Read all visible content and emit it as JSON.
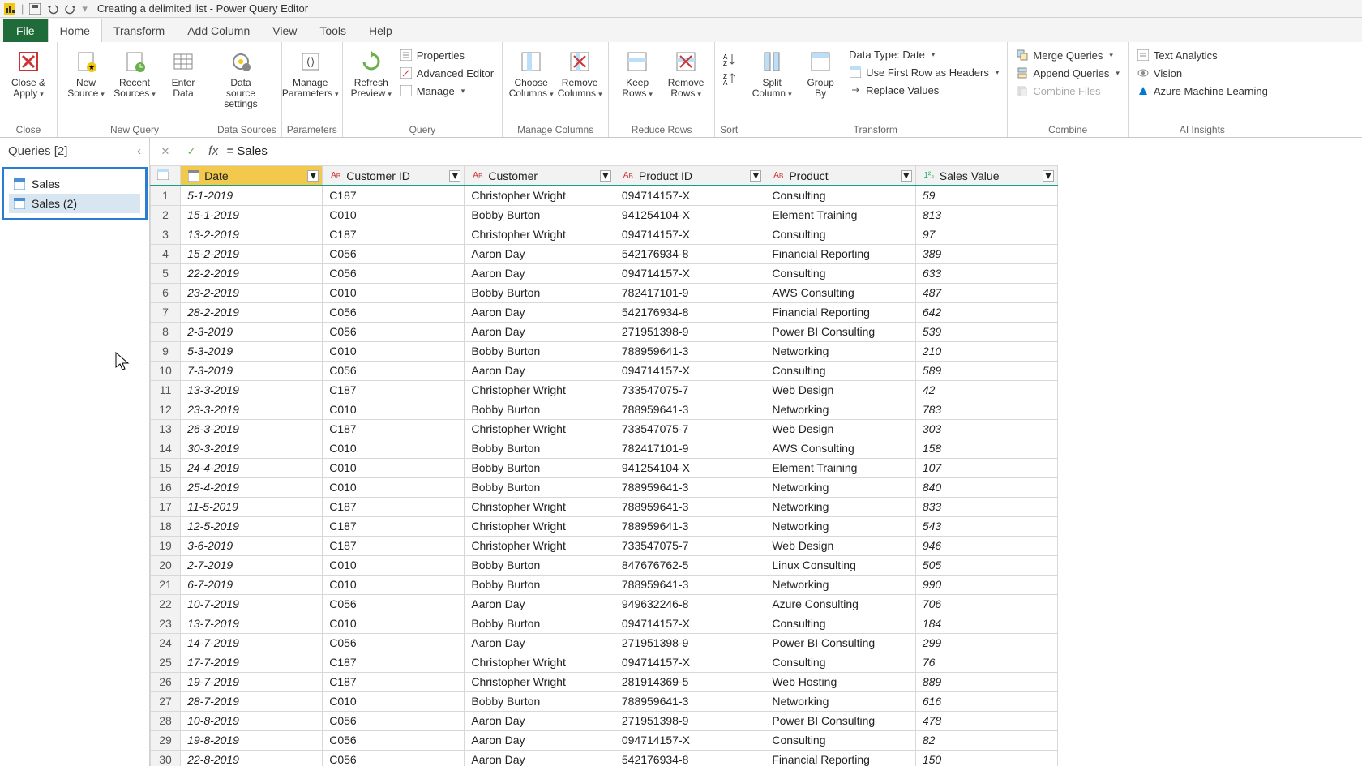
{
  "title": "Creating a delimited list - Power Query Editor",
  "menus": {
    "file": "File",
    "home": "Home",
    "transform": "Transform",
    "addcol": "Add Column",
    "view": "View",
    "tools": "Tools",
    "help": "Help"
  },
  "ribbon": {
    "close": {
      "closeApply": "Close &\nApply",
      "group": "Close"
    },
    "newquery": {
      "newSource": "New\nSource",
      "recent": "Recent\nSources",
      "enter": "Enter\nData",
      "group": "New Query"
    },
    "datasources": {
      "settings": "Data source\nsettings",
      "group": "Data Sources"
    },
    "params": {
      "manage": "Manage\nParameters",
      "group": "Parameters"
    },
    "query": {
      "refresh": "Refresh\nPreview",
      "properties": "Properties",
      "advanced": "Advanced Editor",
      "manage": "Manage",
      "group": "Query"
    },
    "managecols": {
      "choose": "Choose\nColumns",
      "remove": "Remove\nColumns",
      "group": "Manage Columns"
    },
    "reducerows": {
      "keep": "Keep\nRows",
      "removeR": "Remove\nRows",
      "group": "Reduce Rows"
    },
    "sort": {
      "group": "Sort"
    },
    "transform": {
      "split": "Split\nColumn",
      "groupby": "Group\nBy",
      "datatype": "Data Type: Date",
      "firstrow": "Use First Row as Headers",
      "replace": "Replace Values",
      "group": "Transform"
    },
    "combine": {
      "merge": "Merge Queries",
      "append": "Append Queries",
      "combinefiles": "Combine Files",
      "group": "Combine"
    },
    "ai": {
      "text": "Text Analytics",
      "vision": "Vision",
      "aml": "Azure Machine Learning",
      "group": "AI Insights"
    }
  },
  "queries": {
    "header": "Queries [2]",
    "items": [
      "Sales",
      "Sales (2)"
    ]
  },
  "formula": "= Sales",
  "columns": [
    "Date",
    "Customer ID",
    "Customer",
    "Product ID",
    "Product",
    "Sales Value"
  ],
  "rows": [
    {
      "n": 1,
      "date": "5-1-2019",
      "cid": "C187",
      "cust": "Christopher Wright",
      "pid": "094714157-X",
      "prod": "Consulting",
      "val": "59"
    },
    {
      "n": 2,
      "date": "15-1-2019",
      "cid": "C010",
      "cust": "Bobby Burton",
      "pid": "941254104-X",
      "prod": "Element Training",
      "val": "813"
    },
    {
      "n": 3,
      "date": "13-2-2019",
      "cid": "C187",
      "cust": "Christopher Wright",
      "pid": "094714157-X",
      "prod": "Consulting",
      "val": "97"
    },
    {
      "n": 4,
      "date": "15-2-2019",
      "cid": "C056",
      "cust": "Aaron Day",
      "pid": "542176934-8",
      "prod": "Financial Reporting",
      "val": "389"
    },
    {
      "n": 5,
      "date": "22-2-2019",
      "cid": "C056",
      "cust": "Aaron Day",
      "pid": "094714157-X",
      "prod": "Consulting",
      "val": "633"
    },
    {
      "n": 6,
      "date": "23-2-2019",
      "cid": "C010",
      "cust": "Bobby Burton",
      "pid": "782417101-9",
      "prod": "AWS Consulting",
      "val": "487"
    },
    {
      "n": 7,
      "date": "28-2-2019",
      "cid": "C056",
      "cust": "Aaron Day",
      "pid": "542176934-8",
      "prod": "Financial Reporting",
      "val": "642"
    },
    {
      "n": 8,
      "date": "2-3-2019",
      "cid": "C056",
      "cust": "Aaron Day",
      "pid": "271951398-9",
      "prod": "Power BI Consulting",
      "val": "539"
    },
    {
      "n": 9,
      "date": "5-3-2019",
      "cid": "C010",
      "cust": "Bobby Burton",
      "pid": "788959641-3",
      "prod": "Networking",
      "val": "210"
    },
    {
      "n": 10,
      "date": "7-3-2019",
      "cid": "C056",
      "cust": "Aaron Day",
      "pid": "094714157-X",
      "prod": "Consulting",
      "val": "589"
    },
    {
      "n": 11,
      "date": "13-3-2019",
      "cid": "C187",
      "cust": "Christopher Wright",
      "pid": "733547075-7",
      "prod": "Web Design",
      "val": "42"
    },
    {
      "n": 12,
      "date": "23-3-2019",
      "cid": "C010",
      "cust": "Bobby Burton",
      "pid": "788959641-3",
      "prod": "Networking",
      "val": "783"
    },
    {
      "n": 13,
      "date": "26-3-2019",
      "cid": "C187",
      "cust": "Christopher Wright",
      "pid": "733547075-7",
      "prod": "Web Design",
      "val": "303"
    },
    {
      "n": 14,
      "date": "30-3-2019",
      "cid": "C010",
      "cust": "Bobby Burton",
      "pid": "782417101-9",
      "prod": "AWS Consulting",
      "val": "158"
    },
    {
      "n": 15,
      "date": "24-4-2019",
      "cid": "C010",
      "cust": "Bobby Burton",
      "pid": "941254104-X",
      "prod": "Element Training",
      "val": "107"
    },
    {
      "n": 16,
      "date": "25-4-2019",
      "cid": "C010",
      "cust": "Bobby Burton",
      "pid": "788959641-3",
      "prod": "Networking",
      "val": "840"
    },
    {
      "n": 17,
      "date": "11-5-2019",
      "cid": "C187",
      "cust": "Christopher Wright",
      "pid": "788959641-3",
      "prod": "Networking",
      "val": "833"
    },
    {
      "n": 18,
      "date": "12-5-2019",
      "cid": "C187",
      "cust": "Christopher Wright",
      "pid": "788959641-3",
      "prod": "Networking",
      "val": "543"
    },
    {
      "n": 19,
      "date": "3-6-2019",
      "cid": "C187",
      "cust": "Christopher Wright",
      "pid": "733547075-7",
      "prod": "Web Design",
      "val": "946"
    },
    {
      "n": 20,
      "date": "2-7-2019",
      "cid": "C010",
      "cust": "Bobby Burton",
      "pid": "847676762-5",
      "prod": "Linux Consulting",
      "val": "505"
    },
    {
      "n": 21,
      "date": "6-7-2019",
      "cid": "C010",
      "cust": "Bobby Burton",
      "pid": "788959641-3",
      "prod": "Networking",
      "val": "990"
    },
    {
      "n": 22,
      "date": "10-7-2019",
      "cid": "C056",
      "cust": "Aaron Day",
      "pid": "949632246-8",
      "prod": "Azure Consulting",
      "val": "706"
    },
    {
      "n": 23,
      "date": "13-7-2019",
      "cid": "C010",
      "cust": "Bobby Burton",
      "pid": "094714157-X",
      "prod": "Consulting",
      "val": "184"
    },
    {
      "n": 24,
      "date": "14-7-2019",
      "cid": "C056",
      "cust": "Aaron Day",
      "pid": "271951398-9",
      "prod": "Power BI Consulting",
      "val": "299"
    },
    {
      "n": 25,
      "date": "17-7-2019",
      "cid": "C187",
      "cust": "Christopher Wright",
      "pid": "094714157-X",
      "prod": "Consulting",
      "val": "76"
    },
    {
      "n": 26,
      "date": "19-7-2019",
      "cid": "C187",
      "cust": "Christopher Wright",
      "pid": "281914369-5",
      "prod": "Web Hosting",
      "val": "889"
    },
    {
      "n": 27,
      "date": "28-7-2019",
      "cid": "C010",
      "cust": "Bobby Burton",
      "pid": "788959641-3",
      "prod": "Networking",
      "val": "616"
    },
    {
      "n": 28,
      "date": "10-8-2019",
      "cid": "C056",
      "cust": "Aaron Day",
      "pid": "271951398-9",
      "prod": "Power BI Consulting",
      "val": "478"
    },
    {
      "n": 29,
      "date": "19-8-2019",
      "cid": "C056",
      "cust": "Aaron Day",
      "pid": "094714157-X",
      "prod": "Consulting",
      "val": "82"
    },
    {
      "n": 30,
      "date": "22-8-2019",
      "cid": "C056",
      "cust": "Aaron Day",
      "pid": "542176934-8",
      "prod": "Financial Reporting",
      "val": "150"
    }
  ]
}
